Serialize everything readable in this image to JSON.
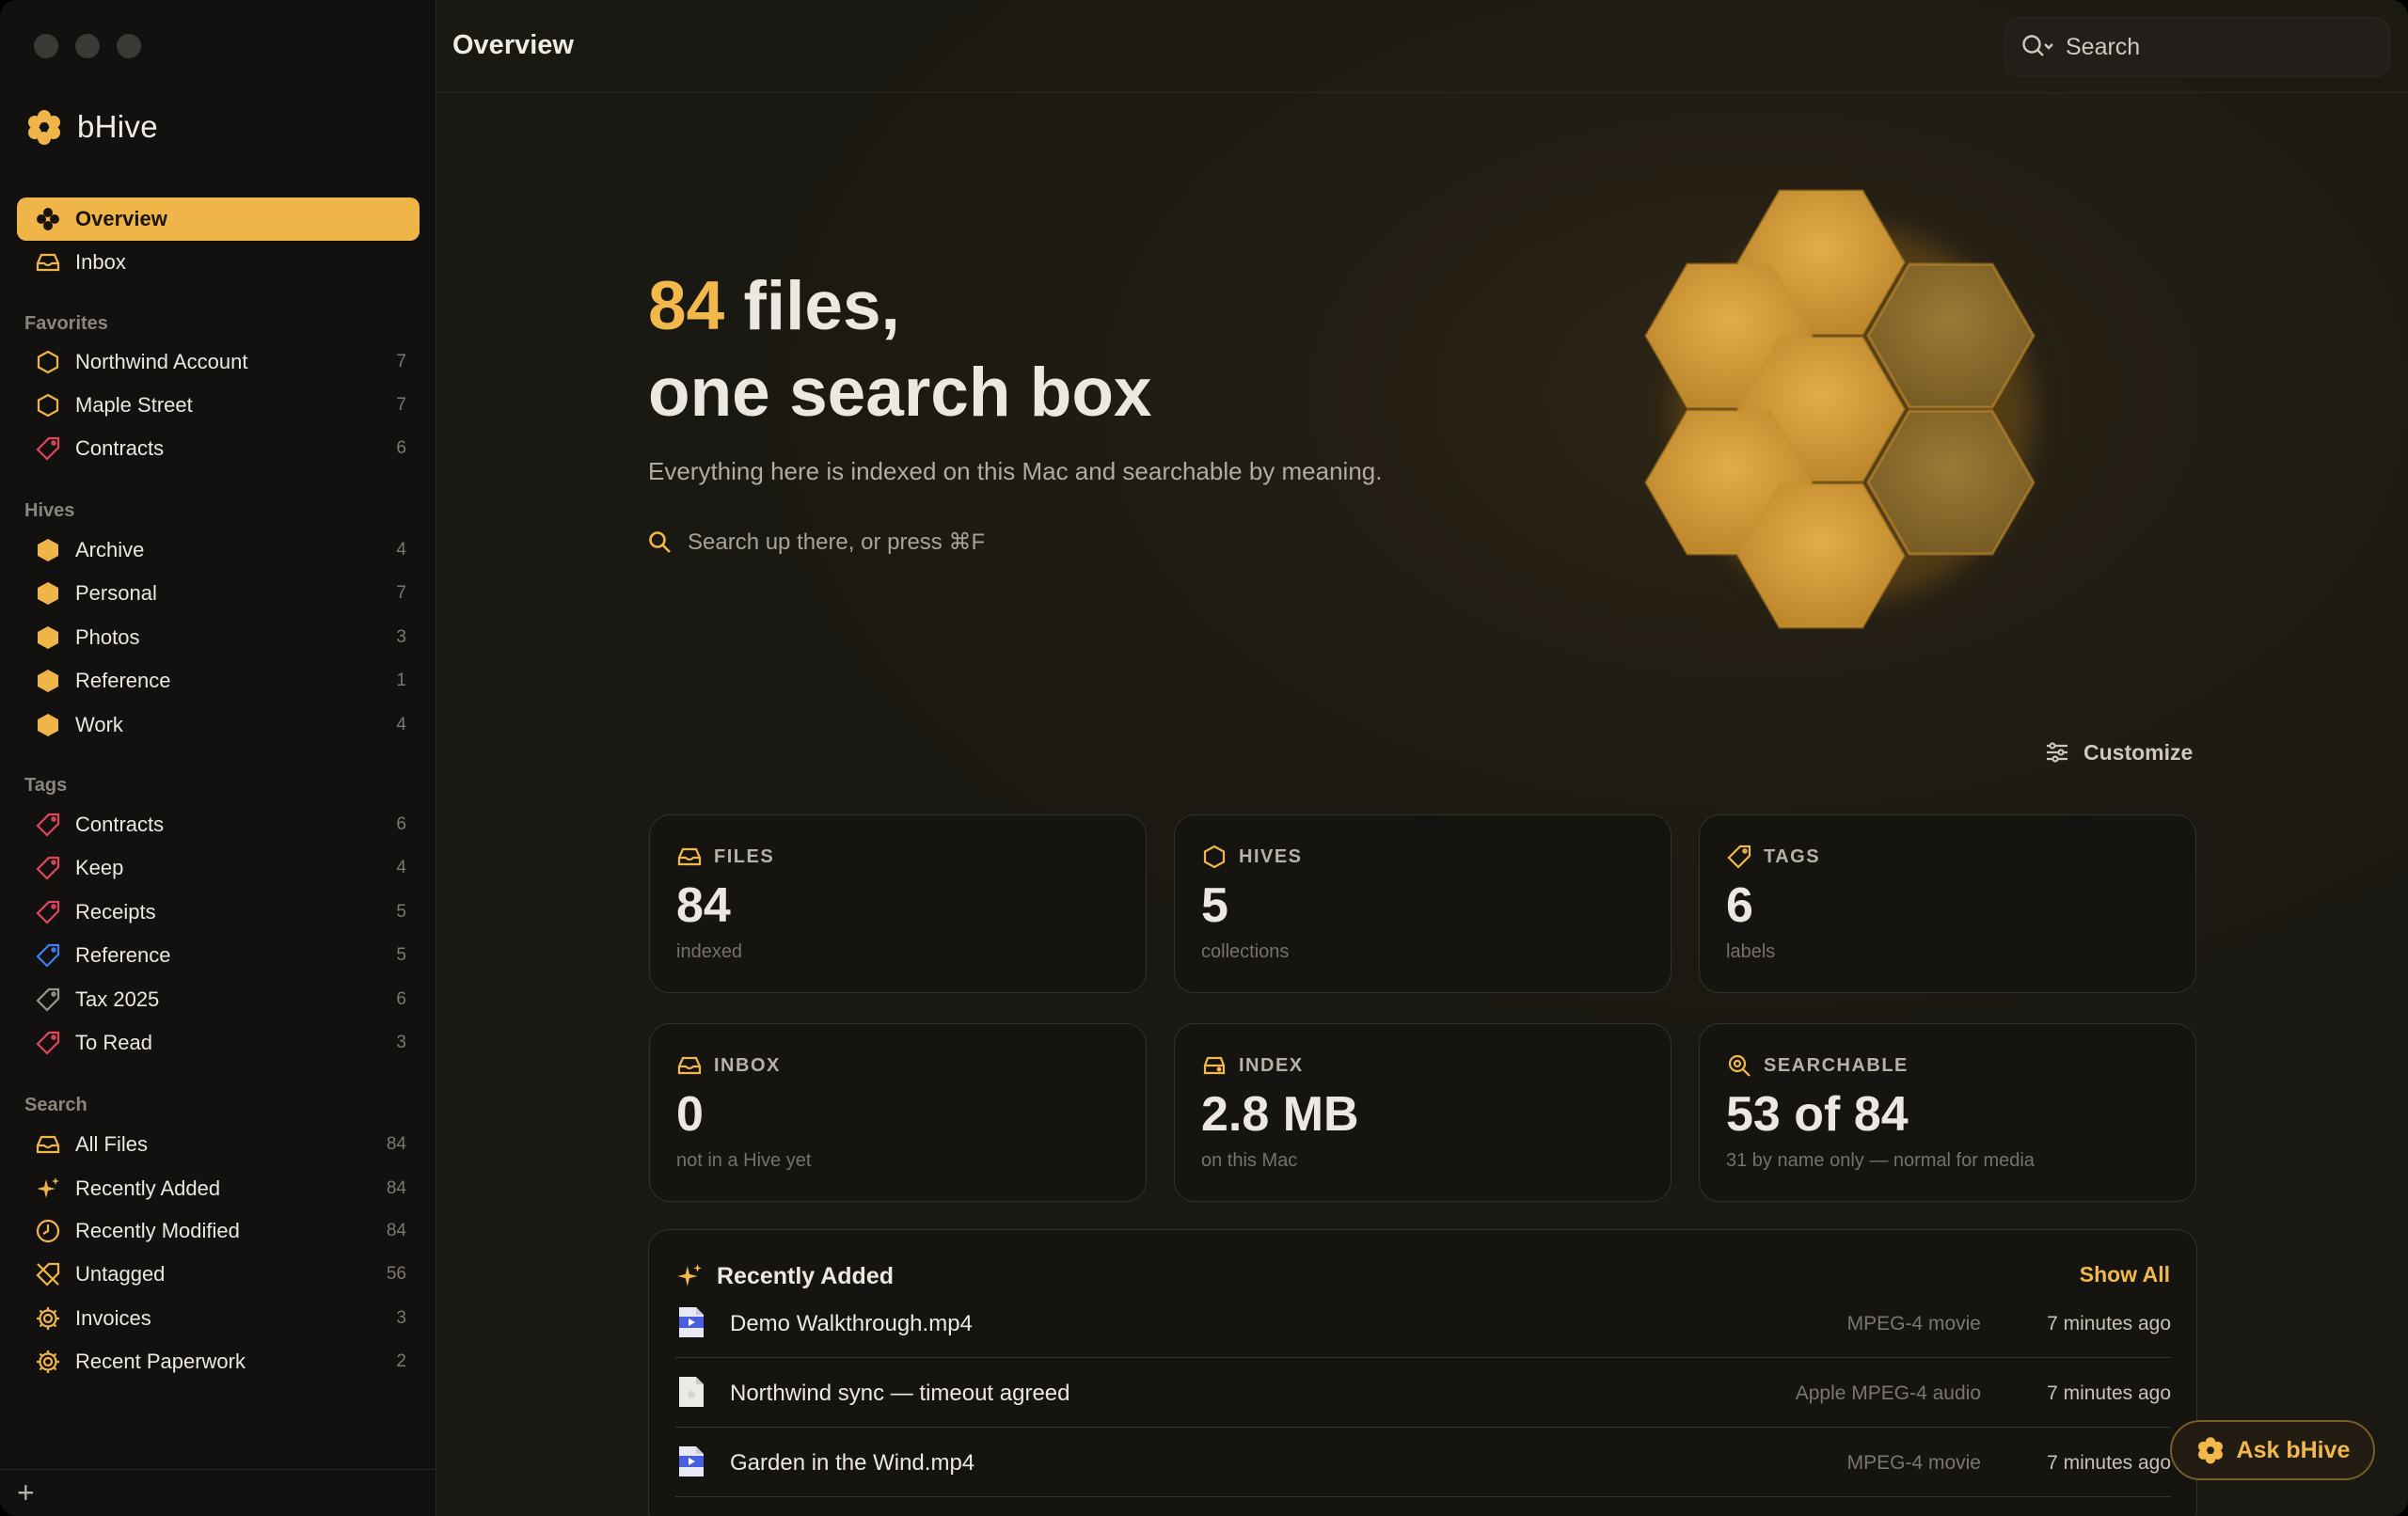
{
  "app": {
    "name": "bHive"
  },
  "sidebar": {
    "primary": [
      {
        "label": "Overview",
        "icon": "overview-icon",
        "active": true
      },
      {
        "label": "Inbox",
        "icon": "inbox-icon"
      }
    ],
    "favorites_label": "Favorites",
    "favorites": [
      {
        "label": "Northwind Account",
        "count": "7",
        "icon": "hexagon-outline-icon"
      },
      {
        "label": "Maple Street",
        "count": "7",
        "icon": "hexagon-outline-icon"
      },
      {
        "label": "Contracts",
        "count": "6",
        "icon": "tag-icon"
      }
    ],
    "hives_label": "Hives",
    "hives": [
      {
        "label": "Archive",
        "count": "4"
      },
      {
        "label": "Personal",
        "count": "7"
      },
      {
        "label": "Photos",
        "count": "3"
      },
      {
        "label": "Reference",
        "count": "1"
      },
      {
        "label": "Work",
        "count": "4"
      }
    ],
    "tags_label": "Tags",
    "tags": [
      {
        "label": "Contracts",
        "count": "6",
        "color": "#e0485a"
      },
      {
        "label": "Keep",
        "count": "4",
        "color": "#e0485a"
      },
      {
        "label": "Receipts",
        "count": "5",
        "color": "#e0485a"
      },
      {
        "label": "Reference",
        "count": "5",
        "color": "#3d7ef0"
      },
      {
        "label": "Tax 2025",
        "count": "6",
        "color": "#9a958d"
      },
      {
        "label": "To Read",
        "count": "3",
        "color": "#e0485a"
      }
    ],
    "search_label": "Search",
    "searches": [
      {
        "label": "All Files",
        "count": "84",
        "icon": "inbox-icon"
      },
      {
        "label": "Recently Added",
        "count": "84",
        "icon": "sparkle-icon"
      },
      {
        "label": "Recently Modified",
        "count": "84",
        "icon": "clock-icon"
      },
      {
        "label": "Untagged",
        "count": "56",
        "icon": "untagged-icon"
      },
      {
        "label": "Invoices",
        "count": "3",
        "icon": "gear-icon"
      },
      {
        "label": "Recent Paperwork",
        "count": "2",
        "icon": "gear-icon"
      }
    ],
    "add_label": "+"
  },
  "header": {
    "title": "Overview",
    "search_placeholder": "Search"
  },
  "hero": {
    "count": "84",
    "line1_rest": " files,",
    "line2": "one search box",
    "subtitle": "Everything here is indexed on this Mac and searchable by meaning.",
    "hint": "Search up there, or press ⌘F"
  },
  "customize_label": "Customize",
  "cards": [
    {
      "label": "FILES",
      "value": "84",
      "sub": "indexed",
      "icon": "inbox-icon"
    },
    {
      "label": "HIVES",
      "value": "5",
      "sub": "collections",
      "icon": "hexagon-outline-icon"
    },
    {
      "label": "TAGS",
      "value": "6",
      "sub": "labels",
      "icon": "tag-icon"
    },
    {
      "label": "INBOX",
      "value": "0",
      "sub": "not in a Hive yet",
      "icon": "inbox-icon"
    },
    {
      "label": "INDEX",
      "value": "2.8 MB",
      "sub": "on this Mac",
      "icon": "drive-icon"
    },
    {
      "label": "SEARCHABLE",
      "value": "53 of 84",
      "sub": "31 by name only — normal for media",
      "icon": "magnifier-icon"
    }
  ],
  "recent": {
    "title": "Recently Added",
    "show_all": "Show All",
    "rows": [
      {
        "name": "Demo Walkthrough.mp4",
        "type": "MPEG-4 movie",
        "time": "7 minutes ago",
        "icon": "movie-file-icon"
      },
      {
        "name": "Northwind sync — timeout agreed",
        "type": "Apple MPEG-4 audio",
        "time": "7 minutes ago",
        "icon": "audio-file-icon"
      },
      {
        "name": "Garden in the Wind.mp4",
        "type": "MPEG-4 movie",
        "time": "7 minutes ago",
        "icon": "movie-file-icon"
      }
    ]
  },
  "ask_label": "Ask bHive",
  "colors": {
    "accent": "#f2b84b",
    "tag_red": "#e0485a",
    "tag_blue": "#3d7ef0"
  }
}
